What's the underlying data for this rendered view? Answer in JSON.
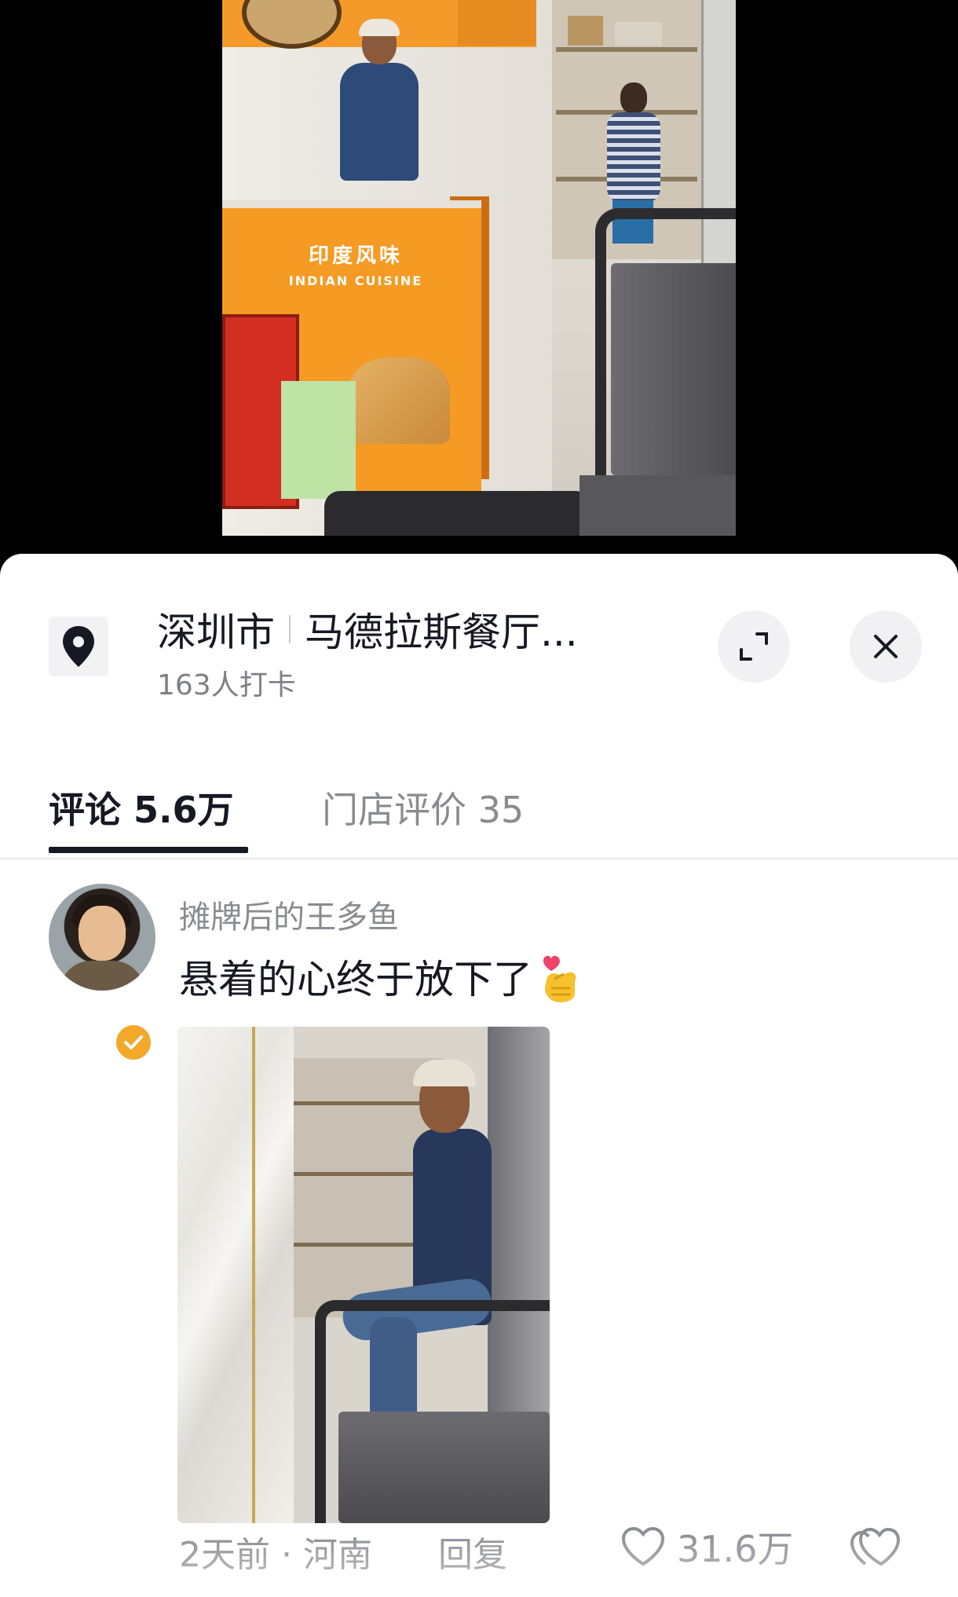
{
  "location": {
    "city": "深圳市",
    "place": "马德拉斯餐厅...",
    "checkins": "163人打卡"
  },
  "video_sign": {
    "cn": "印度风味",
    "en": "INDIAN CUISINE"
  },
  "tabs": [
    {
      "label": "评论 5.6万",
      "active": true
    },
    {
      "label": "门店评价 35",
      "active": false
    }
  ],
  "comment": {
    "username": "摊牌后的王多鱼",
    "text": "悬着的心终于放下了",
    "time_location": "2天前 · 河南",
    "reply_label": "回复",
    "likes": "31.6万"
  },
  "icons": {
    "location": "location-pin-icon",
    "expand": "expand-icon",
    "close": "close-icon",
    "like": "heart-icon",
    "reaction": "heart-hand-emoji"
  },
  "colors": {
    "accent_badge": "#f3a82a",
    "counter_orange": "#f59a23"
  }
}
